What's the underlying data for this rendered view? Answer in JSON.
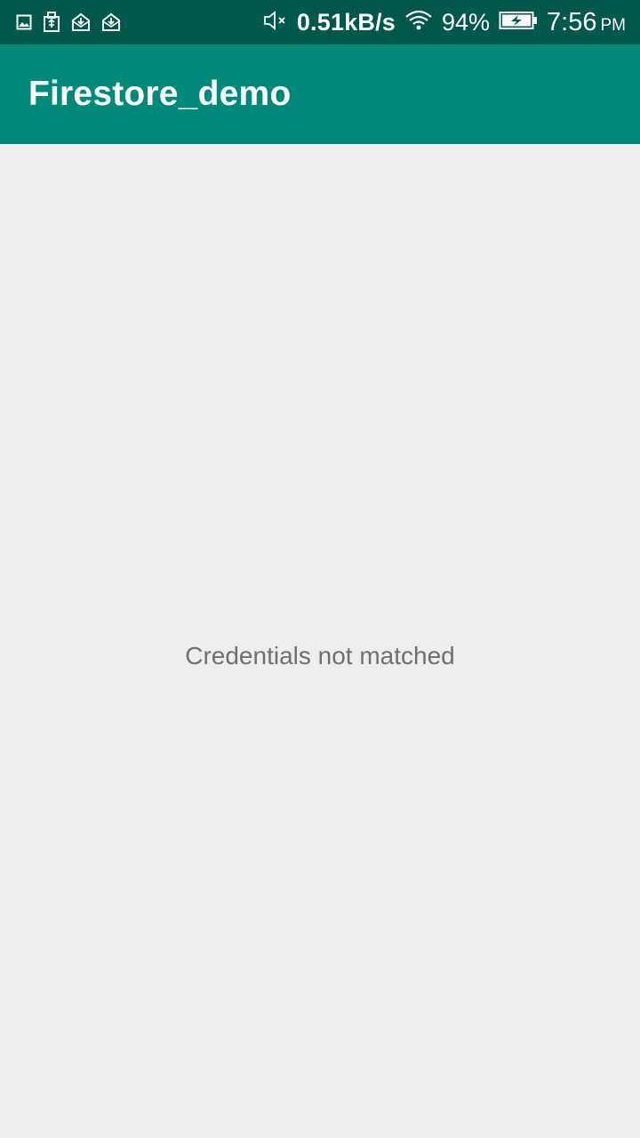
{
  "status_bar": {
    "notification_icons": [
      "gallery-icon",
      "usb-icon",
      "mail-download-icon",
      "mail-download-icon"
    ],
    "mute_icon": "mute-icon",
    "net_speed": "0.51kB/s",
    "wifi_icon": "wifi-icon",
    "battery_percent": "94%",
    "battery_icon": "battery-charging-icon",
    "time": "7:56",
    "time_suffix": "PM"
  },
  "app_bar": {
    "title": "Firestore_demo",
    "color": "#00897b",
    "status_color": "#00574b"
  },
  "main": {
    "message": "Credentials not matched"
  }
}
